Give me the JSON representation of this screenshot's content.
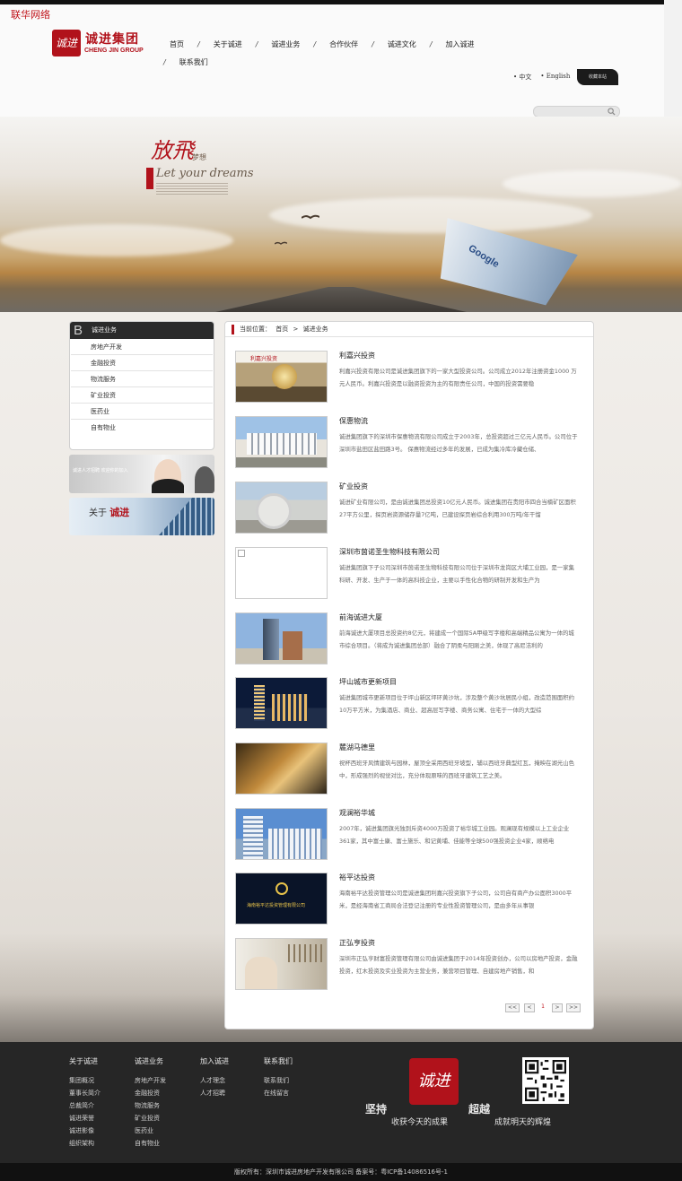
{
  "site_tag": "联华网络",
  "logo": {
    "cn": "诚进集团",
    "en": "CHENG JIN GROUP",
    "seal": "诚进"
  },
  "nav": {
    "row1": [
      "首页",
      "关于诚进",
      "诚进业务",
      "合作伙伴",
      "诚进文化",
      "加入诚进"
    ],
    "row2": [
      "联系我们"
    ]
  },
  "lang": {
    "zh": "中文",
    "en": "English"
  },
  "favorite_label": "收藏本站",
  "search": {
    "placeholder": ""
  },
  "banner": {
    "title": "放飛",
    "subtitle": "梦想",
    "en": "Let your dreams",
    "plane_text": "Google"
  },
  "sidebar": {
    "head_letter": "B",
    "title": "诚进业务",
    "items": [
      "房地产开发",
      "金融投资",
      "物流服务",
      "矿业投资",
      "医药业",
      "自有物业"
    ],
    "promo1_text": "诚进人才招聘 欢迎你的加入",
    "promo2": {
      "prefix": "关于",
      "emph": "诚进"
    }
  },
  "breadcrumb": {
    "label": "当前位置：",
    "home": "首页",
    "sep": ">",
    "current": "诚进业务"
  },
  "items": [
    {
      "title": "利嘉兴投资",
      "desc": "利嘉兴投资有限公司是诚进集团旗下的一家大型投资公司。公司成立2012年注册资金1000 万元人民币。利嘉兴投资是以融资投资为主的有限责任公司，中国的投资需要稳"
    },
    {
      "title": "保惠物流",
      "desc": "诚进集团旗下的深圳市保惠物流有限公司成立于2003年，总投资超过三亿元人民币。公司位于深圳市盐田区盐田路3号。 保惠物流经过多年的发展，已成为集冷库冷藏仓储、"
    },
    {
      "title": "矿业投资",
      "desc": "诚进矿业有限公司，是由诚进集团总投资10亿元人民币。诚进集团在贵阳市四合当楠矿区面积27平方公里，探页岩资源储存量7亿吨，已建设探页岩综合利用300万吨/年干馏"
    },
    {
      "title": "深圳市茵诺圣生物科技有限公司",
      "desc": "诚进集团旗下子公司深圳市茵诺圣生物科技有限公司位于深圳市龙岗区大埔工业园，是一家集科研、开发、生产于一体的高科技企业，主要以手性化合物的研制开发和生产为"
    },
    {
      "title": "前海诚进大厦",
      "desc": "前海诚进大厦项目总投资约8亿元，将建成一个国际5A甲级写字楼和高端精品公寓为一体的城市综合项目。（将成为诚进集团总部）融合了阴柔与阳刚之美，体现了高尼洁利的"
    },
    {
      "title": "坪山城市更新项目",
      "desc": "诚进集团城市更新项目位于坪山新区坪环黄沙坑，涉及整个黄沙坑居民小组，改造范围面积约10万平方米，为集酒店、商业、超高层写字楼、商务公寓、住宅于一体的大型综"
    },
    {
      "title": "麓湖马德里",
      "desc": "祝杯西班牙风情建筑与园林，屋顶全采用西班牙坡型，辅以西班牙典型红瓦，掩映在湖光山色中，形成强烈的视觉对比，充分体现原味的西班牙建筑工艺之美。"
    },
    {
      "title": "观澜裕华城",
      "desc": "2007年，诚进集团旗光独到斥资4000万投资了裕华城工业园。观澜现有规模以上工业企业361家，其中富士康、富士施乐、和记黄埔、佳能等全球500强投资企业4家，顺络电"
    },
    {
      "title": "裕平达投资",
      "desc": "海南裕平达投资管理公司是诚进集团利嘉兴投资旗下子公司，公司自有商产办公面积3000平米，是经海南省工商局合法登记注册的专业性投资管理公司，是由多年从事银"
    },
    {
      "title": "正弘亨投资",
      "desc": "深圳市正弘亨财富投资管理有限公司由诚进集团于2014年投资创办，公司以房地产投资，金融投资，红木投资及实业投资为主营业务，兼营项目管理、自建房地产销售，和"
    }
  ],
  "thumb_texts": {
    "item1": "利嘉兴投资",
    "item9": "海南裕平达投资管理有限公司"
  },
  "pager": {
    "first": "<<",
    "prev": "<",
    "current": "1",
    "next": ">",
    "last": ">>"
  },
  "footer": {
    "cols": [
      {
        "title": "关于诚进",
        "links": [
          "集团概况",
          "董事长简介",
          "总裁简介",
          "诚进荣誉",
          "诚进影像",
          "组织架构"
        ]
      },
      {
        "title": "诚进业务",
        "links": [
          "房地产开发",
          "金融投资",
          "物流服务",
          "矿业投资",
          "医药业",
          "自有物业"
        ]
      },
      {
        "title": "加入诚进",
        "links": [
          "人才理念",
          "人才招聘"
        ]
      },
      {
        "title": "联系我们",
        "links": [
          "联系我们",
          "在线留言"
        ]
      }
    ],
    "seal": "诚进",
    "slogan_left": "坚持",
    "slogan_left_sub": "收获今天的成果",
    "slogan_right": "超越",
    "slogan_right_sub": "成就明天的辉煌"
  },
  "copyright": "版权所有：深圳市诚进房地产开发有限公司 备案号：粤ICP备14086516号-1",
  "colors": {
    "brand_red": "#b1121b",
    "dark": "#262626"
  }
}
